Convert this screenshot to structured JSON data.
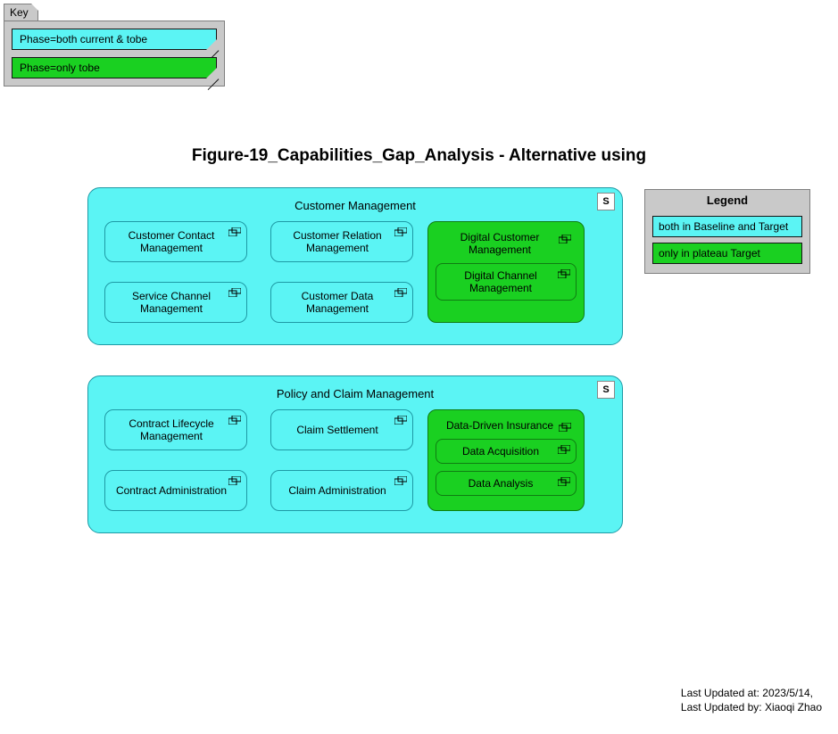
{
  "colors": {
    "cyan": "#5bf4f4",
    "green": "#1ad021",
    "greyPanel": "#c9c9c9"
  },
  "key": {
    "title": "Key",
    "items": [
      {
        "label": "Phase=both current & tobe",
        "color": "cyan"
      },
      {
        "label": "Phase=only tobe",
        "color": "green"
      }
    ]
  },
  "title": "Figure-19_Capabilities_Gap_Analysis - Alternative using",
  "groups": [
    {
      "title": "Customer Management",
      "marker": "S",
      "leftGrid": [
        [
          "Customer Contact Management",
          "Customer Relation Management"
        ],
        [
          "Service Channel Management",
          "Customer Data Management"
        ]
      ],
      "greenBlock": {
        "title": "Digital Customer Management",
        "children": [
          "Digital Channel Management"
        ]
      }
    },
    {
      "title": "Policy and Claim Management",
      "marker": "S",
      "leftGrid": [
        [
          "Contract Lifecycle Management",
          "Claim Settlement"
        ],
        [
          "Contract Administration",
          "Claim Administration"
        ]
      ],
      "greenBlock": {
        "title": "Data-Driven Insurance",
        "children": [
          "Data Acquisition",
          "Data Analysis"
        ]
      }
    }
  ],
  "legend": {
    "title": "Legend",
    "items": [
      {
        "label": "both in Baseline and Target",
        "color": "cyan"
      },
      {
        "label": "only in plateau Target",
        "color": "green"
      }
    ]
  },
  "footer": {
    "line1": "Last Updated at: 2023/5/14,",
    "line2": "Last Updated by: Xiaoqi Zhao"
  }
}
